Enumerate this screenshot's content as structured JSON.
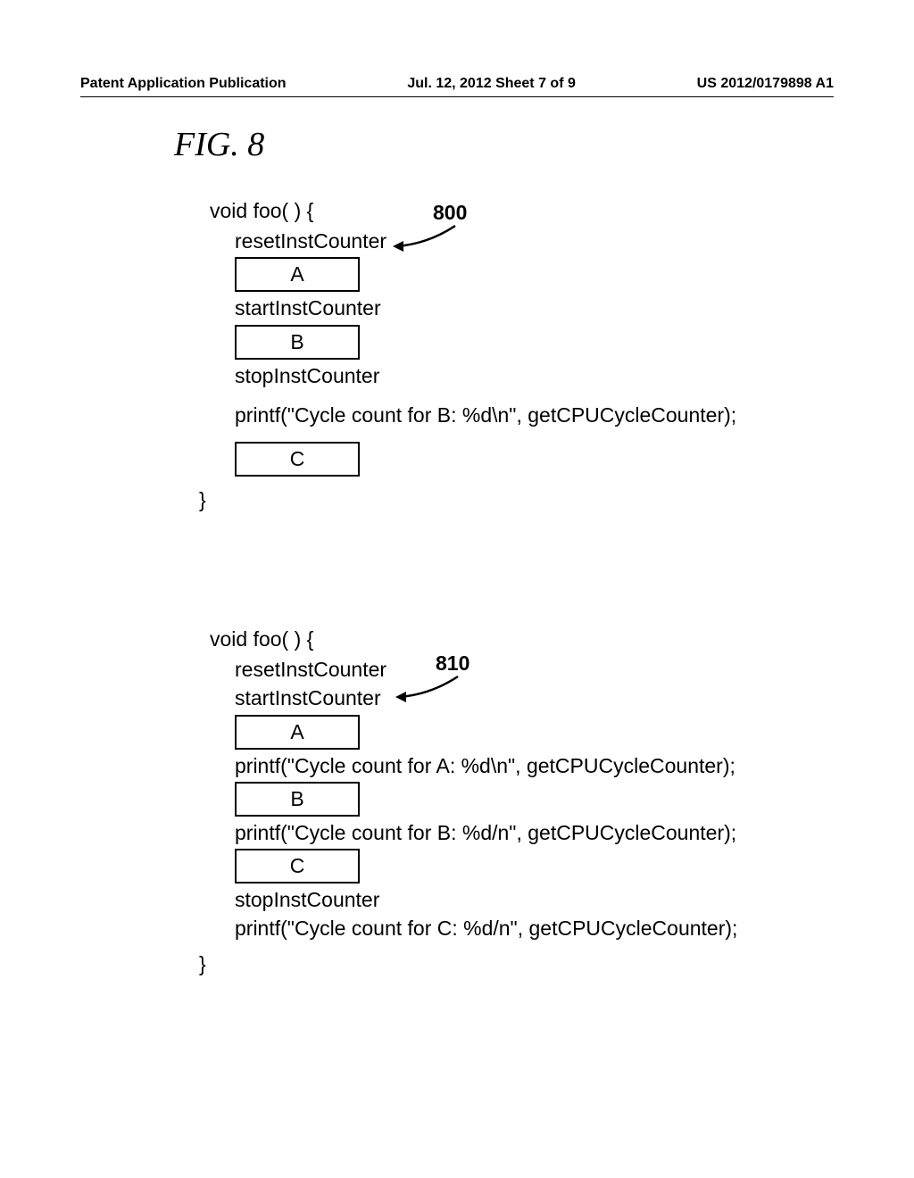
{
  "header": {
    "left": "Patent Application Publication",
    "center": "Jul. 12, 2012  Sheet 7 of 9",
    "right": "US 2012/0179898 A1"
  },
  "figure_title": "FIG. 8",
  "section_800": {
    "ref_num": "800",
    "func_open": "void foo( ) {",
    "reset": "resetInstCounter",
    "box_a": "A",
    "start": "startInstCounter",
    "box_b": "B",
    "stop": "stopInstCounter",
    "printf_b": "printf(\"Cycle count for B: %d\\n\", getCPUCycleCounter);",
    "box_c": "C",
    "func_close": "}"
  },
  "section_810": {
    "ref_num": "810",
    "func_open": "void foo( ) {",
    "reset": "resetInstCounter",
    "start": "startInstCounter",
    "box_a": "A",
    "printf_a": "printf(\"Cycle count for A: %d\\n\", getCPUCycleCounter);",
    "box_b": "B",
    "printf_b": "printf(\"Cycle count for B: %d/n\", getCPUCycleCounter);",
    "box_c": "C",
    "stop": "stopInstCounter",
    "printf_c": "printf(\"Cycle count for C: %d/n\", getCPUCycleCounter);",
    "func_close": "}"
  }
}
